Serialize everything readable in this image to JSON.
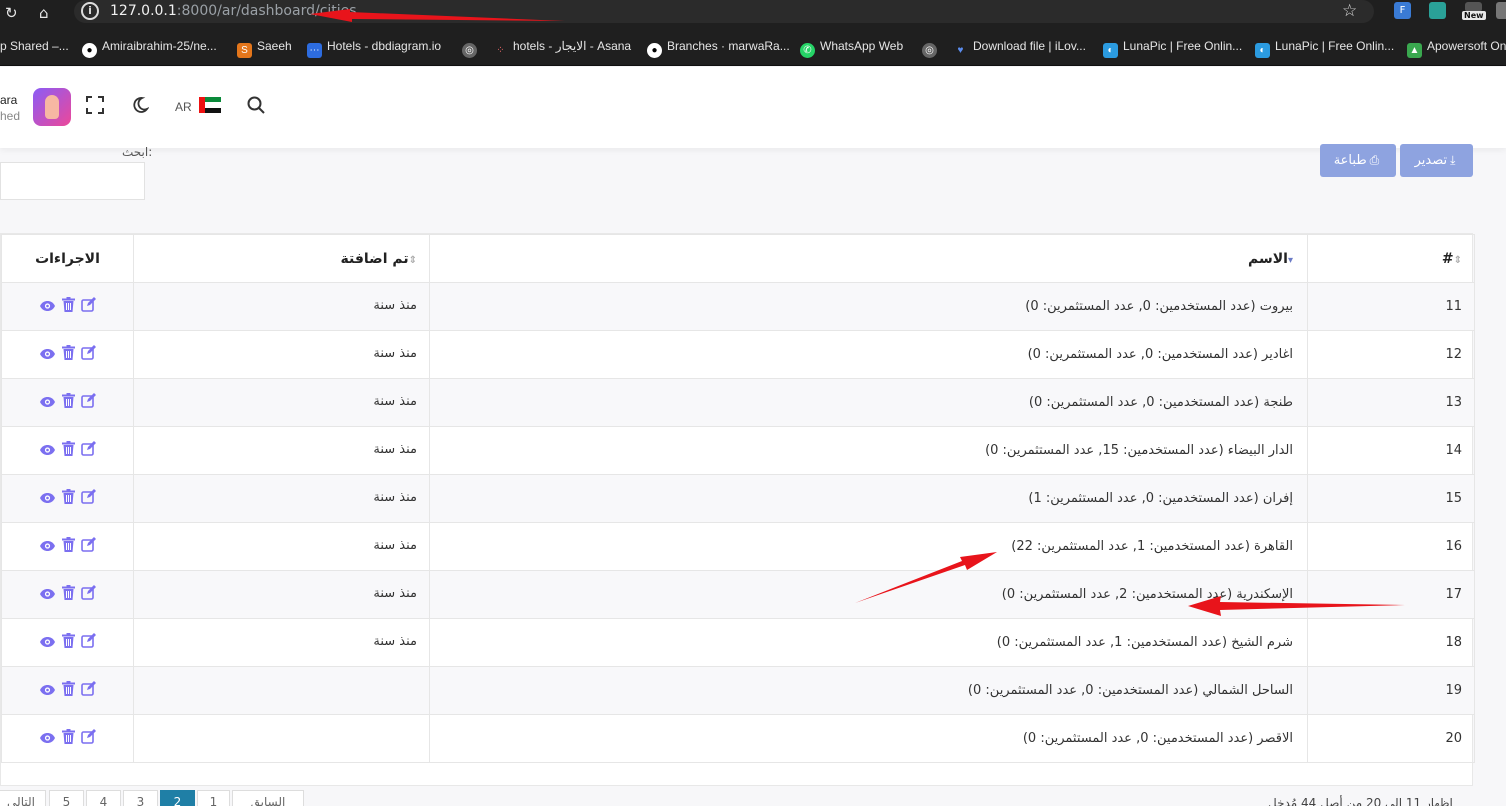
{
  "browser": {
    "url_host": "127.0.0.1",
    "url_path": ":8000/ar/dashboard/cities",
    "bookmarks": [
      {
        "label": "p Shared –...",
        "icon": "folder-icon"
      },
      {
        "label": "Amiraibrahim-25/ne...",
        "icon": "github-icon"
      },
      {
        "label": "Saeeh",
        "icon": "saeeh-icon"
      },
      {
        "label": "Hotels - dbdiagram.io",
        "icon": "dbdiagram-icon"
      },
      {
        "label": "",
        "icon": "globe-icon"
      },
      {
        "label": "hotels - الايجار - Asana",
        "icon": "asana-icon"
      },
      {
        "label": "Branches · marwaRa...",
        "icon": "github-icon"
      },
      {
        "label": "WhatsApp Web",
        "icon": "whatsapp-icon"
      },
      {
        "label": "",
        "icon": "globe-icon"
      },
      {
        "label": "Download file | iLov...",
        "icon": "ilovepdf-icon"
      },
      {
        "label": "LunaPic | Free Onlin...",
        "icon": "lunapic-icon"
      },
      {
        "label": "LunaPic | Free Onlin...",
        "icon": "lunapic-icon"
      },
      {
        "label": "Apowersoft On",
        "icon": "apowersoft-icon"
      }
    ],
    "extension_badge": "New"
  },
  "header": {
    "user_name": "ara",
    "user_role": "hed",
    "lang": "AR"
  },
  "toolbar": {
    "search_label": "ابحث:",
    "print_label": "طباعة",
    "export_label": "تصدير"
  },
  "table": {
    "columns": {
      "num": "#",
      "name": "الاسم",
      "added": "تم اضافتة",
      "actions": "الاجراءات"
    },
    "rows": [
      {
        "num": "11",
        "name": "بيروت (عدد المستخدمين: 0, عدد المستثمرين: 0)",
        "added": "منذ سنة"
      },
      {
        "num": "12",
        "name": "اغادير (عدد المستخدمين: 0, عدد المستثمرين: 0)",
        "added": "منذ سنة"
      },
      {
        "num": "13",
        "name": "طنجة (عدد المستخدمين: 0, عدد المستثمرين: 0)",
        "added": "منذ سنة"
      },
      {
        "num": "14",
        "name": "الدار البيضاء (عدد المستخدمين: 15, عدد المستثمرين: 0)",
        "added": "منذ سنة"
      },
      {
        "num": "15",
        "name": "إفران (عدد المستخدمين: 0, عدد المستثمرين: 1)",
        "added": "منذ سنة"
      },
      {
        "num": "16",
        "name": "القاهرة (عدد المستخدمين: 1, عدد المستثمرين: 22)",
        "added": "منذ سنة"
      },
      {
        "num": "17",
        "name": "الإسكندرية (عدد المستخدمين: 2, عدد المستثمرين: 0)",
        "added": "منذ سنة"
      },
      {
        "num": "18",
        "name": "شرم الشيخ (عدد المستخدمين: 1, عدد المستثمرين: 0)",
        "added": "منذ سنة"
      },
      {
        "num": "19",
        "name": "الساحل الشمالي (عدد المستخدمين: 0, عدد المستثمرين: 0)",
        "added": ""
      },
      {
        "num": "20",
        "name": "الاقصر (عدد المستخدمين: 0, عدد المستثمرين: 0)",
        "added": ""
      }
    ]
  },
  "pagination": {
    "pages": [
      "التالي",
      "5",
      "4",
      "3",
      "2",
      "1",
      "السابق"
    ],
    "active_page": "2",
    "info": "إظهار 11 إلى 20 من أصل 44 مُدخل"
  },
  "colors": {
    "button": "#8ea3e0",
    "action_icon": "#7b6ff0",
    "page_active": "#1f7fa6",
    "arrow": "#e8141b"
  }
}
